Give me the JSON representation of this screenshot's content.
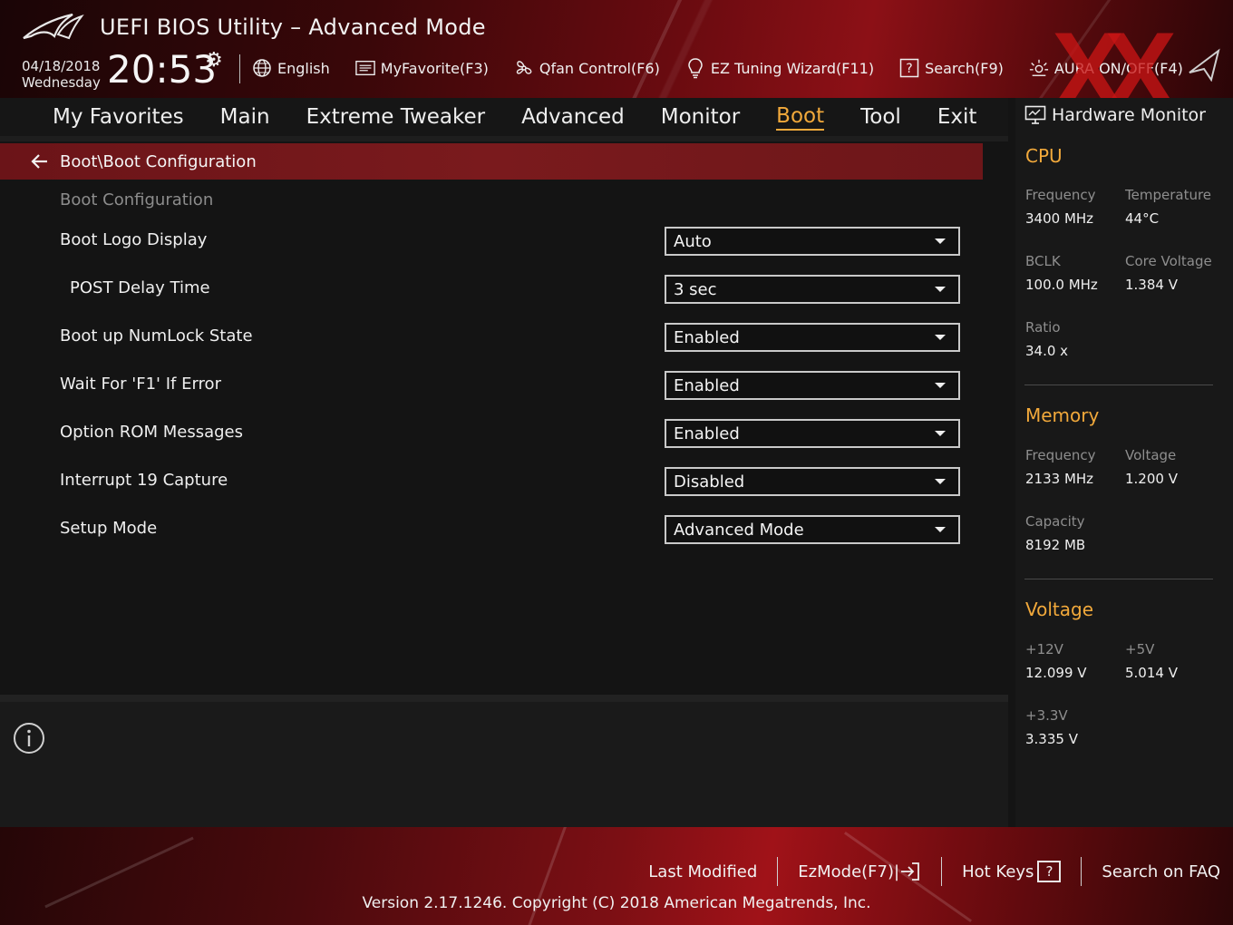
{
  "header": {
    "title": "UEFI BIOS Utility – Advanced Mode",
    "date": "04/18/2018",
    "weekday": "Wednesday",
    "time": "20:53",
    "tools": [
      {
        "label": "English",
        "icon": "globe-icon"
      },
      {
        "label": "MyFavorite(F3)",
        "icon": "favorite-list-icon"
      },
      {
        "label": "Qfan Control(F6)",
        "icon": "fan-icon"
      },
      {
        "label": "EZ Tuning Wizard(F11)",
        "icon": "lightbulb-icon"
      },
      {
        "label": "Search(F9)",
        "icon": "help-box-icon"
      },
      {
        "label": "AURA ON/OFF(F4)",
        "icon": "aura-light-icon"
      }
    ]
  },
  "nav": {
    "tabs": [
      "My Favorites",
      "Main",
      "Extreme Tweaker",
      "Advanced",
      "Monitor",
      "Boot",
      "Tool",
      "Exit"
    ],
    "active": "Boot"
  },
  "content": {
    "breadcrumb": "Boot\\Boot Configuration",
    "section_label": "Boot Configuration",
    "settings": [
      {
        "label": "Boot Logo Display",
        "value": "Auto"
      },
      {
        "label": "POST Delay Time",
        "value": "3 sec"
      },
      {
        "label": "Boot up NumLock State",
        "value": "Enabled"
      },
      {
        "label": "Wait For 'F1' If Error",
        "value": "Enabled"
      },
      {
        "label": "Option ROM Messages",
        "value": "Enabled"
      },
      {
        "label": "Interrupt 19 Capture",
        "value": "Disabled"
      },
      {
        "label": "Setup Mode",
        "value": "Advanced Mode"
      }
    ]
  },
  "hw": {
    "title": "Hardware Monitor",
    "cpu": {
      "heading": "CPU",
      "frequency_label": "Frequency",
      "frequency": "3400 MHz",
      "temperature_label": "Temperature",
      "temperature": "44°C",
      "bclk_label": "BCLK",
      "bclk": "100.0 MHz",
      "core_voltage_label": "Core Voltage",
      "core_voltage": "1.384 V",
      "ratio_label": "Ratio",
      "ratio": "34.0 x"
    },
    "memory": {
      "heading": "Memory",
      "frequency_label": "Frequency",
      "frequency": "2133 MHz",
      "voltage_label": "Voltage",
      "voltage": "1.200 V",
      "capacity_label": "Capacity",
      "capacity": "8192 MB"
    },
    "voltage": {
      "heading": "Voltage",
      "v12_label": "+12V",
      "v12": "12.099 V",
      "v5_label": "+5V",
      "v5": "5.014 V",
      "v33_label": "+3.3V",
      "v33": "3.335 V"
    }
  },
  "footer": {
    "last_modified": "Last Modified",
    "ezmode": "EzMode(F7)|",
    "hot_keys": "Hot Keys",
    "hot_keys_key": "?",
    "search_faq": "Search on FAQ",
    "version": "Version 2.17.1246. Copyright (C) 2018 American Megatrends, Inc."
  },
  "watermark": "XX",
  "colors": {
    "accent": "#f2a93b",
    "breadcrumb": "#7a1a1d",
    "watermark": "#c81414"
  }
}
